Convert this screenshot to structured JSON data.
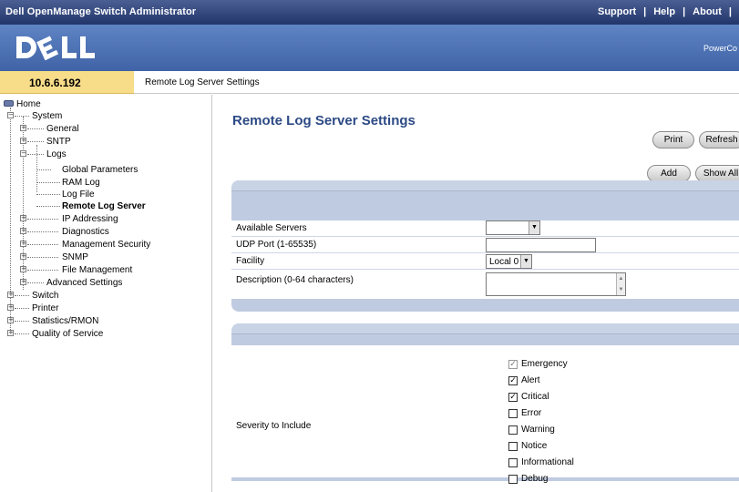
{
  "app": {
    "title": "Dell OpenManage Switch Administrator",
    "top_links": [
      "Support",
      "Help",
      "About"
    ],
    "product_name": "PowerCo"
  },
  "header": {
    "ip": "10.6.6.192",
    "breadcrumb": "Remote Log Server Settings"
  },
  "tree": {
    "home": "Home",
    "system": "System",
    "general": "General",
    "sntp": "SNTP",
    "logs": "Logs",
    "global_parameters": "Global Parameters",
    "ram_log": "RAM Log",
    "log_file": "Log File",
    "remote_log_server": "Remote Log Server",
    "ip_addressing": "IP Addressing",
    "diagnostics": "Diagnostics",
    "management_security": "Management Security",
    "snmp": "SNMP",
    "file_management": "File Management",
    "advanced_settings": "Advanced Settings",
    "switch": "Switch",
    "statistics_rmon": "Statistics/RMON",
    "quality_of_service": "Quality of Service",
    "extra": "Printer"
  },
  "main": {
    "title": "Remote Log Server Settings",
    "buttons": {
      "print": "Print",
      "refresh": "Refresh",
      "add": "Add",
      "show_all": "Show All"
    },
    "form": {
      "available_servers_label": "Available Servers",
      "available_servers_value": "",
      "udp_port_label": "UDP Port (1-65535)",
      "udp_port_value": "",
      "facility_label": "Facility",
      "facility_value": "Local 0",
      "description_label": "Description (0-64 characters)",
      "description_value": ""
    },
    "severity": {
      "label": "Severity to Include",
      "levels": [
        {
          "name": "Emergency",
          "checked": true,
          "disabled": true
        },
        {
          "name": "Alert",
          "checked": true,
          "disabled": false
        },
        {
          "name": "Critical",
          "checked": true,
          "disabled": false
        },
        {
          "name": "Error",
          "checked": false,
          "disabled": false
        },
        {
          "name": "Warning",
          "checked": false,
          "disabled": false
        },
        {
          "name": "Notice",
          "checked": false,
          "disabled": false
        },
        {
          "name": "Informational",
          "checked": false,
          "disabled": false
        },
        {
          "name": "Debug",
          "checked": false,
          "disabled": false
        }
      ]
    }
  },
  "colors": {
    "title_bar": "#22356b",
    "brand_band": "#4a6fb3",
    "ip_box": "#f7dc8a",
    "page_title": "#2c4a85",
    "panel": "#bfcbe0"
  }
}
